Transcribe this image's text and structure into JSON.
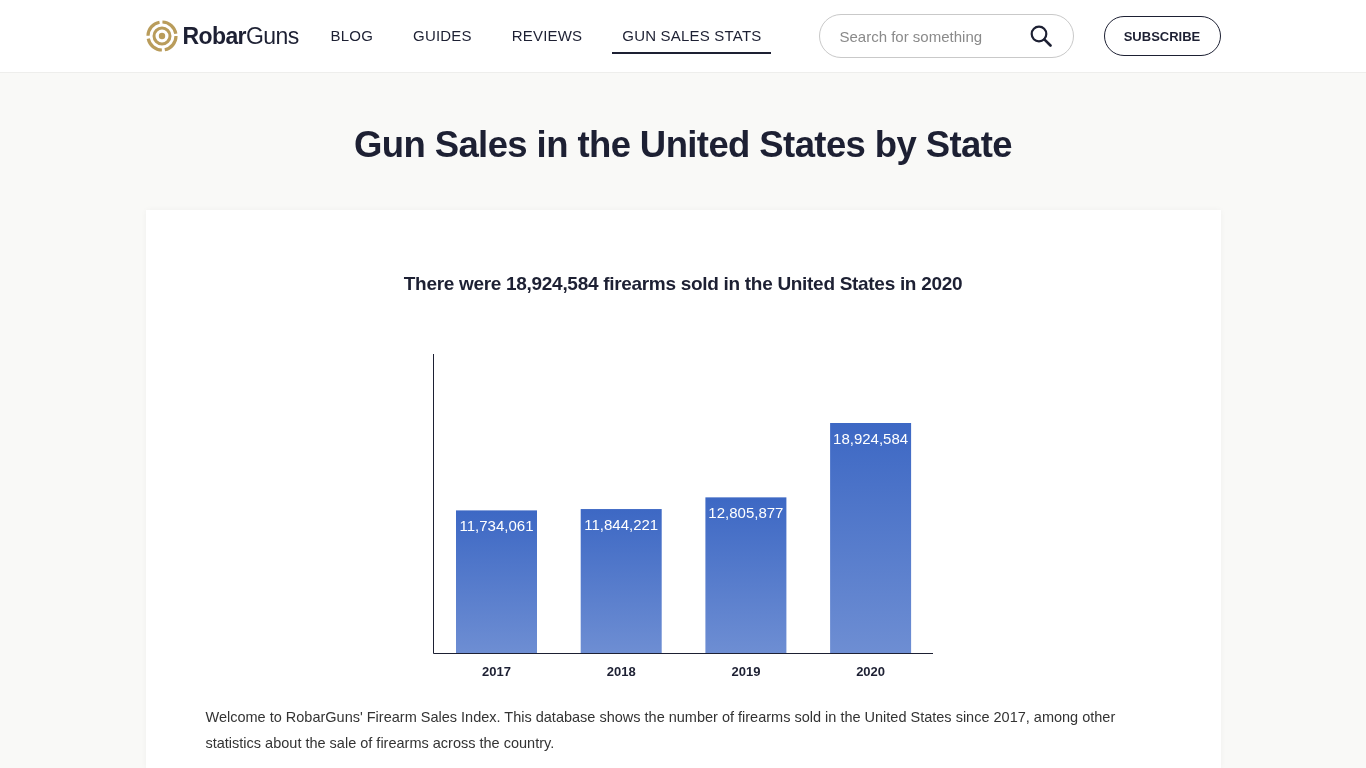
{
  "header": {
    "logo": "**Robar**Guns",
    "nav": [
      {
        "label": "BLOG",
        "selected": false
      },
      {
        "label": "GUIDES",
        "selected": false
      },
      {
        "label": "REVIEWS",
        "selected": false
      },
      {
        "label": "GUN SALES STATS",
        "selected": true
      }
    ],
    "search": {
      "placeholder": "Search for something"
    },
    "subscribe": "SUBSCRIBE"
  },
  "page": {
    "title": "Gun Sales in the United States by State"
  },
  "card": {
    "chart": {
      "chart_data": {
        "type": "bar",
        "title": "There were 18,924,584 firearms sold in the United States in 2020",
        "categories": [
          "2017",
          "2018",
          "2019",
          "2020"
        ],
        "series": [
          {
            "color": "#3d68c4",
            "values": [
              11734061,
              11844221,
              12805877,
              18924584
            ],
            "value_labels": [
              "11,734,061",
              "11,844,221",
              "12,805,877",
              "18,924,584"
            ]
          }
        ]
      }
    },
    "intro": "Welcome to RobarGuns' Firearm Sales Index. This database shows the number of firearms sold in the United States since 2017, among other statistics about the sale of firearms across the country."
  }
}
